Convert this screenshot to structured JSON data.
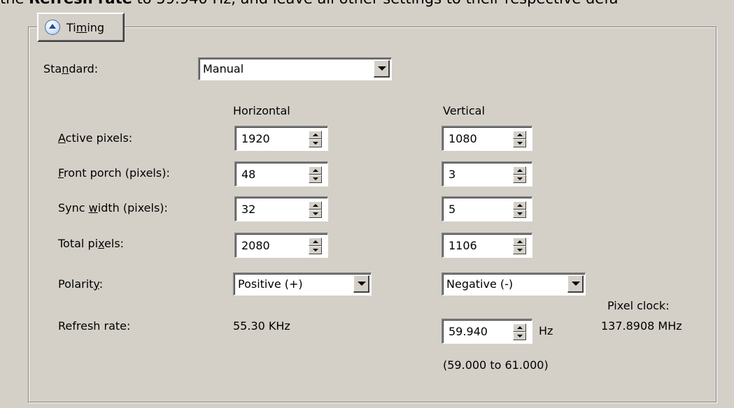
{
  "instruction": {
    "pre": "the ",
    "bold": "Refresh rate",
    "post": " to 59.940 Hz, and leave all other settings to their respective defa"
  },
  "timing": {
    "label_pre": "Ti",
    "label_ul": "m",
    "label_post": "ing",
    "icon": "collapse-up-icon"
  },
  "standard": {
    "label_pre": "Sta",
    "label_ul": "n",
    "label_post": "dard:",
    "value": "Manual"
  },
  "headers": {
    "horizontal": "Horizontal",
    "vertical": "Vertical"
  },
  "rows": {
    "active": {
      "label_ul": "A",
      "label_post": "ctive pixels:",
      "h": "1920",
      "v": "1080"
    },
    "front": {
      "label_ul": "F",
      "label_post": "ront porch (pixels):",
      "h": "48",
      "v": "3"
    },
    "sync": {
      "label_pre": "Sync ",
      "label_ul": "w",
      "label_post": "idth (pixels):",
      "h": "32",
      "v": "5"
    },
    "total": {
      "label_pre": "Total pi",
      "label_ul": "x",
      "label_post": "els:",
      "h": "2080",
      "v": "1106"
    },
    "polarity": {
      "label_pre": "Polarit",
      "label_ul": "y",
      "label_post": ":",
      "h": "Positive (+)",
      "v": "Negative (-)"
    },
    "refresh": {
      "label": "Refresh rate:",
      "h": "55.30 KHz",
      "v": "59.940",
      "unit": "Hz",
      "range": "(59.000 to 61.000)"
    }
  },
  "pixel_clock": {
    "label": "Pixel clock:",
    "value": "137.8908 MHz"
  }
}
